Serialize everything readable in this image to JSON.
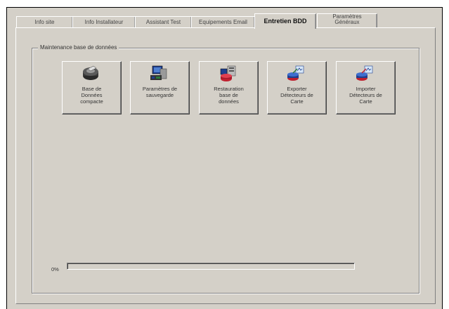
{
  "tabs": [
    {
      "label": "Info site",
      "active": false
    },
    {
      "label": "Info Installateur",
      "active": false
    },
    {
      "label": "Assistant Test",
      "active": false
    },
    {
      "label": "Equipements Email",
      "active": false
    },
    {
      "label": "Entretien BDD",
      "active": true
    },
    {
      "label_line1": "Paramètres",
      "label_line2": "Généraux",
      "active": false
    }
  ],
  "group": {
    "title": "Maintenance base de données"
  },
  "buttons": [
    {
      "label": "Base de\nDonnées\ncompacte",
      "icon": "database-disk-icon"
    },
    {
      "label": "Paramètres de\nsauvegarde",
      "icon": "computer-backup-icon"
    },
    {
      "label": "Restauration\nbase de\ndonnées",
      "icon": "database-restore-icon"
    },
    {
      "label": "Exporter\nDétecteurs de\nCarte",
      "icon": "export-detectors-icon"
    },
    {
      "label": "Importer\nDétecteurs de\nCarte",
      "icon": "import-detectors-icon"
    }
  ],
  "progress": {
    "label": "0%",
    "value_percent": 0
  }
}
